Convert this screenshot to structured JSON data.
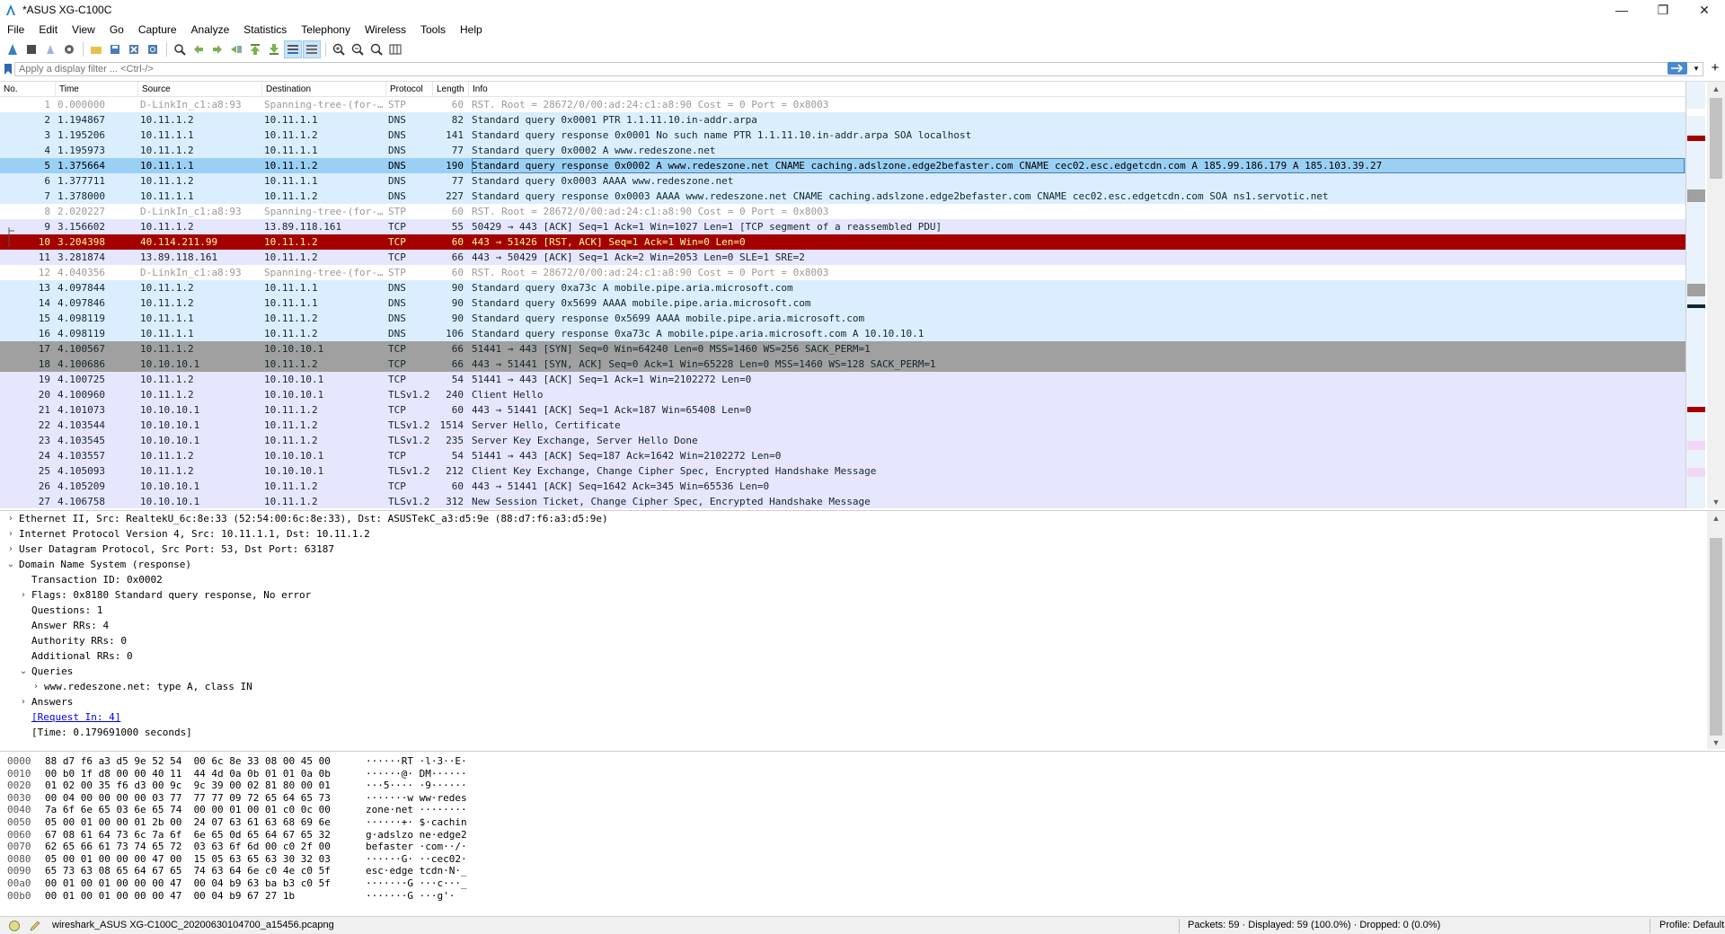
{
  "window": {
    "title": "*ASUS XG-C100C"
  },
  "menu": [
    "File",
    "Edit",
    "View",
    "Go",
    "Capture",
    "Analyze",
    "Statistics",
    "Telephony",
    "Wireless",
    "Tools",
    "Help"
  ],
  "filter": {
    "placeholder": "Apply a display filter ... <Ctrl-/>"
  },
  "columns": {
    "no": "No.",
    "time": "Time",
    "source": "Source",
    "destination": "Destination",
    "protocol": "Protocol",
    "length": "Length",
    "info": "Info"
  },
  "packets": [
    {
      "no": "1",
      "time": "0.000000",
      "src": "D-LinkIn_c1:a8:93",
      "dst": "Spanning-tree-(for-…",
      "proto": "STP",
      "len": "60",
      "info": "RST. Root = 28672/0/00:ad:24:c1:a8:90  Cost = 0  Port = 0x8003",
      "style": "stp"
    },
    {
      "no": "2",
      "time": "1.194867",
      "src": "10.11.1.2",
      "dst": "10.11.1.1",
      "proto": "DNS",
      "len": "82",
      "info": "Standard query 0x0001 PTR 1.1.11.10.in-addr.arpa",
      "style": "dns"
    },
    {
      "no": "3",
      "time": "1.195206",
      "src": "10.11.1.1",
      "dst": "10.11.1.2",
      "proto": "DNS",
      "len": "141",
      "info": "Standard query response 0x0001 No such name PTR 1.1.11.10.in-addr.arpa SOA localhost",
      "style": "dns"
    },
    {
      "no": "4",
      "time": "1.195973",
      "src": "10.11.1.2",
      "dst": "10.11.1.1",
      "proto": "DNS",
      "len": "77",
      "info": "Standard query 0x0002 A www.redeszone.net",
      "style": "dns"
    },
    {
      "no": "5",
      "time": "1.375664",
      "src": "10.11.1.1",
      "dst": "10.11.1.2",
      "proto": "DNS",
      "len": "190",
      "info": "Standard query response 0x0002 A www.redeszone.net CNAME caching.adslzone.edge2befaster.com CNAME cec02.esc.edgetcdn.com A 185.99.186.179 A 185.103.39.27",
      "style": "sel"
    },
    {
      "no": "6",
      "time": "1.377711",
      "src": "10.11.1.2",
      "dst": "10.11.1.1",
      "proto": "DNS",
      "len": "77",
      "info": "Standard query 0x0003 AAAA www.redeszone.net",
      "style": "dns"
    },
    {
      "no": "7",
      "time": "1.378000",
      "src": "10.11.1.1",
      "dst": "10.11.1.2",
      "proto": "DNS",
      "len": "227",
      "info": "Standard query response 0x0003 AAAA www.redeszone.net CNAME caching.adslzone.edge2befaster.com CNAME cec02.esc.edgetcdn.com SOA ns1.servotic.net",
      "style": "dns"
    },
    {
      "no": "8",
      "time": "2.020227",
      "src": "D-LinkIn_c1:a8:93",
      "dst": "Spanning-tree-(for-…",
      "proto": "STP",
      "len": "60",
      "info": "RST. Root = 28672/0/00:ad:24:c1:a8:90  Cost = 0  Port = 0x8003",
      "style": "stp"
    },
    {
      "no": "9",
      "time": "3.156602",
      "src": "10.11.1.2",
      "dst": "13.89.118.161",
      "proto": "TCP",
      "len": "55",
      "info": "50429 → 443 [ACK] Seq=1 Ack=1 Win=1027 Len=1 [TCP segment of a reassembled PDU]",
      "style": "tcp"
    },
    {
      "no": "10",
      "time": "3.204398",
      "src": "40.114.211.99",
      "dst": "10.11.1.2",
      "proto": "TCP",
      "len": "60",
      "info": "443 → 51426 [RST, ACK] Seq=1 Ack=1 Win=0 Len=0",
      "style": "rst"
    },
    {
      "no": "11",
      "time": "3.281874",
      "src": "13.89.118.161",
      "dst": "10.11.1.2",
      "proto": "TCP",
      "len": "66",
      "info": "443 → 50429 [ACK] Seq=1 Ack=2 Win=2053 Len=0 SLE=1 SRE=2",
      "style": "tcp"
    },
    {
      "no": "12",
      "time": "4.040356",
      "src": "D-LinkIn_c1:a8:93",
      "dst": "Spanning-tree-(for-…",
      "proto": "STP",
      "len": "60",
      "info": "RST. Root = 28672/0/00:ad:24:c1:a8:90  Cost = 0  Port = 0x8003",
      "style": "stp"
    },
    {
      "no": "13",
      "time": "4.097844",
      "src": "10.11.1.2",
      "dst": "10.11.1.1",
      "proto": "DNS",
      "len": "90",
      "info": "Standard query 0xa73c A mobile.pipe.aria.microsoft.com",
      "style": "dns"
    },
    {
      "no": "14",
      "time": "4.097846",
      "src": "10.11.1.2",
      "dst": "10.11.1.1",
      "proto": "DNS",
      "len": "90",
      "info": "Standard query 0x5699 AAAA mobile.pipe.aria.microsoft.com",
      "style": "dns"
    },
    {
      "no": "15",
      "time": "4.098119",
      "src": "10.11.1.1",
      "dst": "10.11.1.2",
      "proto": "DNS",
      "len": "90",
      "info": "Standard query response 0x5699 AAAA mobile.pipe.aria.microsoft.com",
      "style": "dns"
    },
    {
      "no": "16",
      "time": "4.098119",
      "src": "10.11.1.1",
      "dst": "10.11.1.2",
      "proto": "DNS",
      "len": "106",
      "info": "Standard query response 0xa73c A mobile.pipe.aria.microsoft.com A 10.10.10.1",
      "style": "dns"
    },
    {
      "no": "17",
      "time": "4.100567",
      "src": "10.11.1.2",
      "dst": "10.10.10.1",
      "proto": "TCP",
      "len": "66",
      "info": "51441 → 443 [SYN] Seq=0 Win=64240 Len=0 MSS=1460 WS=256 SACK_PERM=1",
      "style": "tcpgray"
    },
    {
      "no": "18",
      "time": "4.100686",
      "src": "10.10.10.1",
      "dst": "10.11.1.2",
      "proto": "TCP",
      "len": "66",
      "info": "443 → 51441 [SYN, ACK] Seq=0 Ack=1 Win=65228 Len=0 MSS=1460 WS=128 SACK_PERM=1",
      "style": "tcpgray"
    },
    {
      "no": "19",
      "time": "4.100725",
      "src": "10.11.1.2",
      "dst": "10.10.10.1",
      "proto": "TCP",
      "len": "54",
      "info": "51441 → 443 [ACK] Seq=1 Ack=1 Win=2102272 Len=0",
      "style": "tcp"
    },
    {
      "no": "20",
      "time": "4.100960",
      "src": "10.11.1.2",
      "dst": "10.10.10.1",
      "proto": "TLSv1.2",
      "len": "240",
      "info": "Client Hello",
      "style": "tls"
    },
    {
      "no": "21",
      "time": "4.101073",
      "src": "10.10.10.1",
      "dst": "10.11.1.2",
      "proto": "TCP",
      "len": "60",
      "info": "443 → 51441 [ACK] Seq=1 Ack=187 Win=65408 Len=0",
      "style": "tcp"
    },
    {
      "no": "22",
      "time": "4.103544",
      "src": "10.10.10.1",
      "dst": "10.11.1.2",
      "proto": "TLSv1.2",
      "len": "1514",
      "info": "Server Hello, Certificate",
      "style": "tls"
    },
    {
      "no": "23",
      "time": "4.103545",
      "src": "10.10.10.1",
      "dst": "10.11.1.2",
      "proto": "TLSv1.2",
      "len": "235",
      "info": "Server Key Exchange, Server Hello Done",
      "style": "tls"
    },
    {
      "no": "24",
      "time": "4.103557",
      "src": "10.11.1.2",
      "dst": "10.10.10.1",
      "proto": "TCP",
      "len": "54",
      "info": "51441 → 443 [ACK] Seq=187 Ack=1642 Win=2102272 Len=0",
      "style": "tcp"
    },
    {
      "no": "25",
      "time": "4.105093",
      "src": "10.11.1.2",
      "dst": "10.10.10.1",
      "proto": "TLSv1.2",
      "len": "212",
      "info": "Client Key Exchange, Change Cipher Spec, Encrypted Handshake Message",
      "style": "tls"
    },
    {
      "no": "26",
      "time": "4.105209",
      "src": "10.10.10.1",
      "dst": "10.11.1.2",
      "proto": "TCP",
      "len": "60",
      "info": "443 → 51441 [ACK] Seq=1642 Ack=345 Win=65536 Len=0",
      "style": "tcp"
    },
    {
      "no": "27",
      "time": "4.106758",
      "src": "10.10.10.1",
      "dst": "10.11.1.2",
      "proto": "TLSv1.2",
      "len": "312",
      "info": "New Session Ticket, Change Cipher Spec, Encrypted Handshake Message",
      "style": "tls"
    }
  ],
  "details": [
    {
      "level": 0,
      "arrow": "›",
      "text": "Ethernet II, Src: RealtekU_6c:8e:33 (52:54:00:6c:8e:33), Dst: ASUSTekC_a3:d5:9e (88:d7:f6:a3:d5:9e)"
    },
    {
      "level": 0,
      "arrow": "›",
      "text": "Internet Protocol Version 4, Src: 10.11.1.1, Dst: 10.11.1.2"
    },
    {
      "level": 0,
      "arrow": "›",
      "text": "User Datagram Protocol, Src Port: 53, Dst Port: 63187"
    },
    {
      "level": 0,
      "arrow": "⌄",
      "text": "Domain Name System (response)"
    },
    {
      "level": 1,
      "arrow": "",
      "text": "Transaction ID: 0x0002"
    },
    {
      "level": 1,
      "arrow": "›",
      "text": "Flags: 0x8180 Standard query response, No error"
    },
    {
      "level": 1,
      "arrow": "",
      "text": "Questions: 1"
    },
    {
      "level": 1,
      "arrow": "",
      "text": "Answer RRs: 4"
    },
    {
      "level": 1,
      "arrow": "",
      "text": "Authority RRs: 0"
    },
    {
      "level": 1,
      "arrow": "",
      "text": "Additional RRs: 0"
    },
    {
      "level": 1,
      "arrow": "⌄",
      "text": "Queries"
    },
    {
      "level": 2,
      "arrow": "›",
      "text": "www.redeszone.net: type A, class IN"
    },
    {
      "level": 1,
      "arrow": "›",
      "text": "Answers"
    },
    {
      "level": 1,
      "arrow": "",
      "text": "[Request In: 4]",
      "link": true
    },
    {
      "level": 1,
      "arrow": "",
      "text": "[Time: 0.179691000 seconds]"
    }
  ],
  "hex": [
    {
      "off": "0000",
      "bytes": "88 d7 f6 a3 d5 9e 52 54  00 6c 8e 33 08 00 45 00",
      "ascii": "······RT ·l·3··E·"
    },
    {
      "off": "0010",
      "bytes": "00 b0 1f d8 00 00 40 11  44 4d 0a 0b 01 01 0a 0b",
      "ascii": "······@· DM······"
    },
    {
      "off": "0020",
      "bytes": "01 02 00 35 f6 d3 00 9c  9c 39 00 02 81 80 00 01",
      "ascii": "···5···· ·9······"
    },
    {
      "off": "0030",
      "bytes": "00 04 00 00 00 00 03 77  77 77 09 72 65 64 65 73",
      "ascii": "·······w ww·redes"
    },
    {
      "off": "0040",
      "bytes": "7a 6f 6e 65 03 6e 65 74  00 00 01 00 01 c0 0c 00",
      "ascii": "zone·net ········"
    },
    {
      "off": "0050",
      "bytes": "05 00 01 00 00 01 2b 00  24 07 63 61 63 68 69 6e",
      "ascii": "······+· $·cachin"
    },
    {
      "off": "0060",
      "bytes": "67 08 61 64 73 6c 7a 6f  6e 65 0d 65 64 67 65 32",
      "ascii": "g·adslzo ne·edge2"
    },
    {
      "off": "0070",
      "bytes": "62 65 66 61 73 74 65 72  03 63 6f 6d 00 c0 2f 00",
      "ascii": "befaster ·com··/·"
    },
    {
      "off": "0080",
      "bytes": "05 00 01 00 00 00 47 00  15 05 63 65 63 30 32 03",
      "ascii": "······G· ··cec02·"
    },
    {
      "off": "0090",
      "bytes": "65 73 63 08 65 64 67 65  74 63 64 6e c0 4e c0 5f",
      "ascii": "esc·edge tcdn·N·_"
    },
    {
      "off": "00a0",
      "bytes": "00 01 00 01 00 00 00 47  00 04 b9 63 ba b3 c0 5f",
      "ascii": "·······G ···c···_"
    },
    {
      "off": "00b0",
      "bytes": "00 01 00 01 00 00 00 47  00 04 b9 67 27 1b",
      "ascii": "·······G ···g'·"
    }
  ],
  "status": {
    "file": "wireshark_ASUS XG-C100C_20200630104700_a15456.pcapng",
    "stats": "Packets: 59 · Displayed: 59 (100.0%) · Dropped: 0 (0.0%)",
    "profile": "Profile: Default"
  },
  "colors": {
    "dns": "#daeeff",
    "tcp": "#e7e6ff",
    "rst": "#a40000",
    "rst_text": "#fffc9c",
    "selected": "#9bd0f5",
    "gray": "#a0a0a0"
  }
}
